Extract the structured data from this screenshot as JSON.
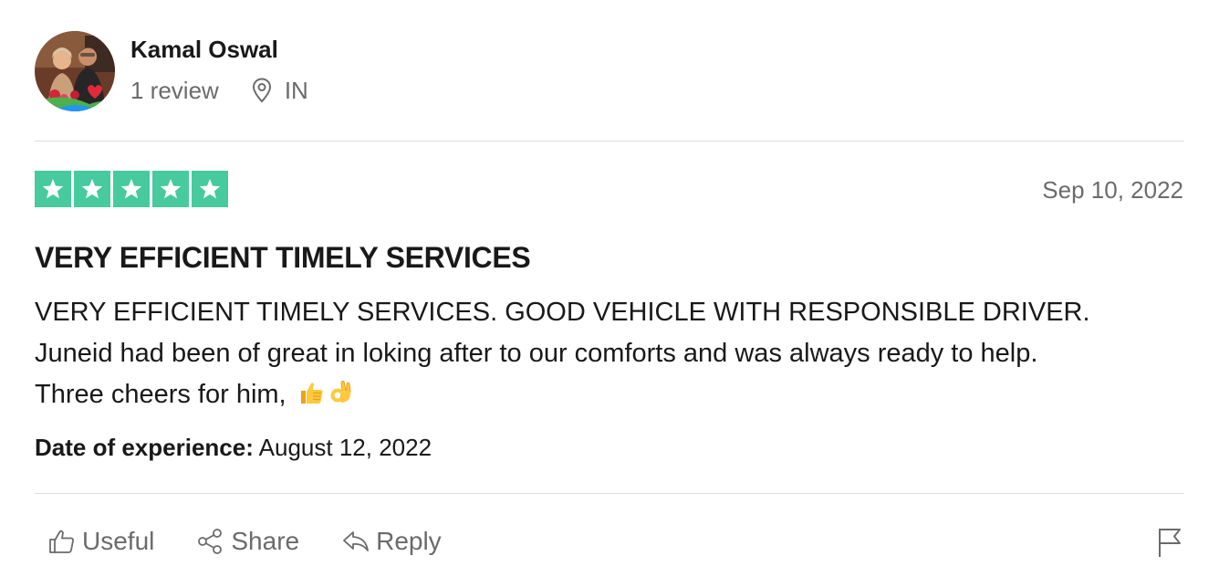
{
  "reviewer": {
    "name": "Kamal Oswal",
    "review_count": "1 review",
    "country": "IN"
  },
  "review": {
    "rating": 5,
    "rating_color": "#00b67a",
    "date": "Sep 10, 2022",
    "title": "VERY EFFICIENT TIMELY SERVICES",
    "body_lines": [
      "VERY EFFICIENT TIMELY SERVICES. GOOD VEHICLE WITH RESPONSIBLE DRIVER.",
      "Juneid had been of great in loking after to our comforts and was always ready to help.",
      "Three cheers for him, "
    ],
    "body_emojis": [
      "thumbs-up-emoji",
      "ok-hand-emoji"
    ],
    "experience_label": "Date of experience:",
    "experience_date": " August 12, 2022"
  },
  "actions": {
    "useful_label": "Useful",
    "share_label": "Share",
    "reply_label": "Reply"
  },
  "icons": {
    "location": "location-pin-icon",
    "useful": "thumbs-up-icon",
    "share": "share-icon",
    "reply": "reply-icon",
    "report": "flag-icon"
  }
}
